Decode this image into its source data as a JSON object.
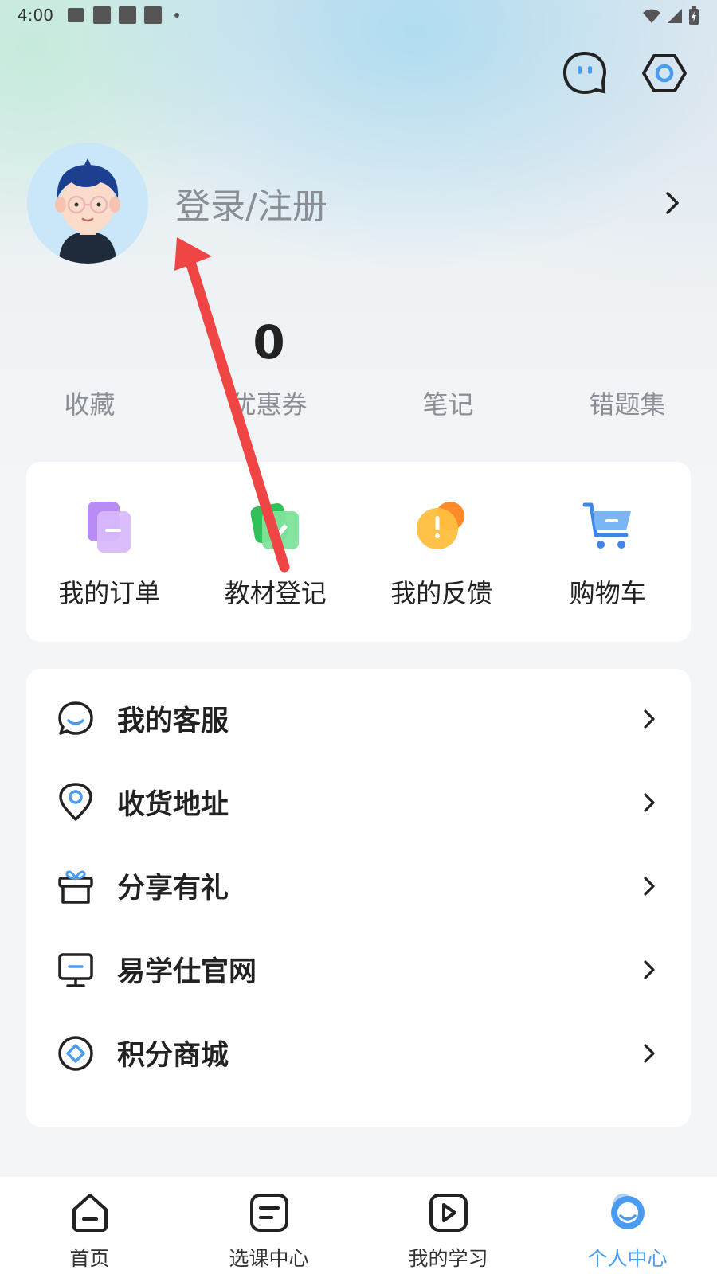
{
  "status_bar": {
    "time": "4:00"
  },
  "profile": {
    "login_label": "登录/注册"
  },
  "stats": [
    {
      "value": "",
      "label": "收藏"
    },
    {
      "value": "0",
      "label": "优惠券"
    },
    {
      "value": "",
      "label": "笔记"
    },
    {
      "value": "",
      "label": "错题集"
    }
  ],
  "quick_actions": [
    {
      "label": "我的订单",
      "icon": "order-icon"
    },
    {
      "label": "教材登记",
      "icon": "textbook-register-icon"
    },
    {
      "label": "我的反馈",
      "icon": "feedback-icon"
    },
    {
      "label": "购物车",
      "icon": "cart-icon"
    }
  ],
  "menu": [
    {
      "label": "我的客服",
      "icon": "customer-service-icon"
    },
    {
      "label": "收货地址",
      "icon": "location-pin-icon"
    },
    {
      "label": "分享有礼",
      "icon": "gift-icon"
    },
    {
      "label": "易学仕官网",
      "icon": "monitor-icon"
    },
    {
      "label": "积分商城",
      "icon": "points-mall-icon"
    }
  ],
  "tabs": [
    {
      "label": "首页",
      "icon": "home-icon",
      "active": false
    },
    {
      "label": "选课中心",
      "icon": "course-center-icon",
      "active": false
    },
    {
      "label": "我的学习",
      "icon": "play-icon",
      "active": false
    },
    {
      "label": "个人中心",
      "icon": "profile-icon",
      "active": true
    }
  ],
  "colors": {
    "accent": "#4a9cf0",
    "annotation_arrow": "#f04545"
  }
}
